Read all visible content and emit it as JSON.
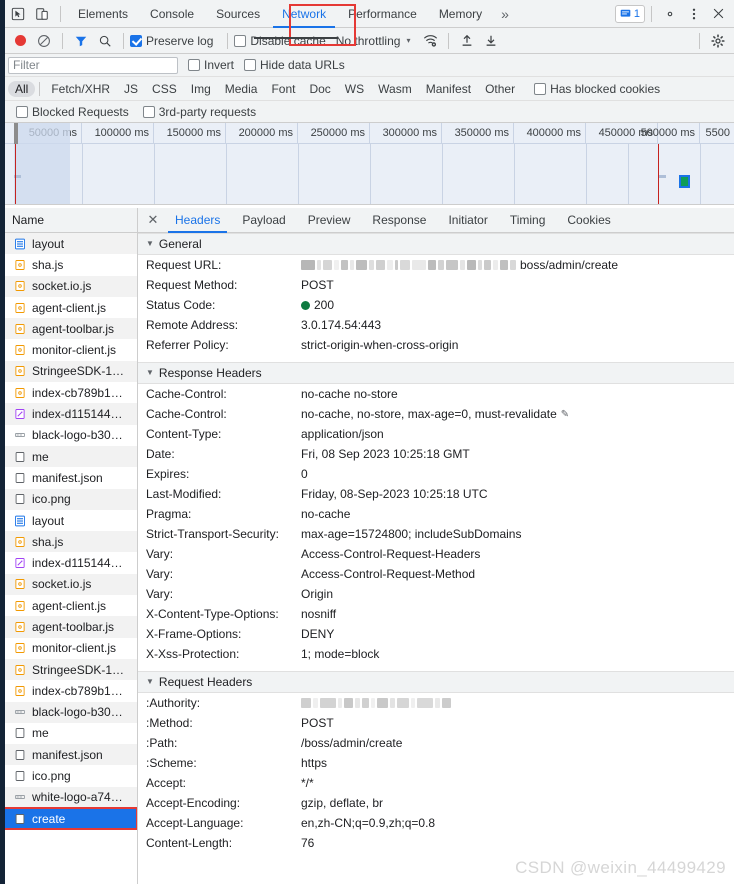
{
  "window": {
    "main_tabs": [
      {
        "label": "Elements",
        "selected": false
      },
      {
        "label": "Console",
        "selected": false
      },
      {
        "label": "Sources",
        "selected": false
      },
      {
        "label": "Network",
        "selected": true
      },
      {
        "label": "Performance",
        "selected": false
      },
      {
        "label": "Memory",
        "selected": false
      }
    ],
    "more_tabs_glyph": "»",
    "message_count": "1",
    "icons": {
      "inspect": "inspect-element-icon",
      "device": "device-toolbar-icon",
      "settings": "gear-icon",
      "kebab": "more-options-icon",
      "close": "close-icon"
    }
  },
  "toolbar": {
    "record_label": "record-button",
    "clear_label": "clear-button",
    "filter_toggle_label": "filter-toggle",
    "search_label": "search-button",
    "preserve_log": {
      "label": "Preserve log",
      "checked": true
    },
    "disable_cache": {
      "label": "Disable cache",
      "checked": false
    },
    "throttling": {
      "value": "No throttling",
      "caret": "▾"
    },
    "wifi_label": "network-conditions-icon",
    "import_label": "import-har-icon",
    "export_label": "export-har-icon",
    "settings_label": "network-settings-gear-icon"
  },
  "filters": {
    "filter_placeholder": "Filter",
    "filter_value": "",
    "invert": {
      "label": "Invert",
      "checked": false
    },
    "hide_data_urls": {
      "label": "Hide data URLs",
      "checked": false
    },
    "types": [
      {
        "label": "All",
        "selected": true
      },
      {
        "label": "Fetch/XHR",
        "selected": false
      },
      {
        "label": "JS",
        "selected": false
      },
      {
        "label": "CSS",
        "selected": false
      },
      {
        "label": "Img",
        "selected": false
      },
      {
        "label": "Media",
        "selected": false
      },
      {
        "label": "Font",
        "selected": false
      },
      {
        "label": "Doc",
        "selected": false
      },
      {
        "label": "WS",
        "selected": false
      },
      {
        "label": "Wasm",
        "selected": false
      },
      {
        "label": "Manifest",
        "selected": false
      },
      {
        "label": "Other",
        "selected": false
      }
    ],
    "has_blocked_cookies": {
      "label": "Has blocked cookies",
      "checked": false
    },
    "blocked_requests": {
      "label": "Blocked Requests",
      "checked": false
    },
    "third_party": {
      "label": "3rd-party requests",
      "checked": false
    }
  },
  "overview": {
    "ticks": [
      "50000 ms",
      "100000 ms",
      "150000 ms",
      "200000 ms",
      "250000 ms",
      "300000 ms",
      "350000 ms",
      "400000 ms",
      "450000 ms",
      "500000 ms",
      "5500"
    ],
    "marker_color": "#c5221f",
    "event_color": "#0f9d58"
  },
  "requests": {
    "column_header": "Name",
    "rows": [
      {
        "name": "layout",
        "icon": "document-icon"
      },
      {
        "name": "sha.js",
        "icon": "script-icon"
      },
      {
        "name": "socket.io.js",
        "icon": "script-icon"
      },
      {
        "name": "agent-client.js",
        "icon": "script-icon"
      },
      {
        "name": "agent-toolbar.js",
        "icon": "script-icon"
      },
      {
        "name": "monitor-client.js",
        "icon": "script-icon"
      },
      {
        "name": "StringeeSDK-1…",
        "icon": "script-icon"
      },
      {
        "name": "index-cb789b1…",
        "icon": "script-icon"
      },
      {
        "name": "index-d115144…",
        "icon": "stylesheet-icon"
      },
      {
        "name": "black-logo-b30…",
        "icon": "image-icon"
      },
      {
        "name": "me",
        "icon": "xhr-icon"
      },
      {
        "name": "manifest.json",
        "icon": "xhr-icon"
      },
      {
        "name": "ico.png",
        "icon": "xhr-icon"
      },
      {
        "name": "layout",
        "icon": "document-icon"
      },
      {
        "name": "sha.js",
        "icon": "script-icon"
      },
      {
        "name": "index-d115144…",
        "icon": "stylesheet-icon"
      },
      {
        "name": "socket.io.js",
        "icon": "script-icon"
      },
      {
        "name": "agent-client.js",
        "icon": "script-icon"
      },
      {
        "name": "agent-toolbar.js",
        "icon": "script-icon"
      },
      {
        "name": "monitor-client.js",
        "icon": "script-icon"
      },
      {
        "name": "StringeeSDK-1…",
        "icon": "script-icon"
      },
      {
        "name": "index-cb789b1…",
        "icon": "script-icon"
      },
      {
        "name": "black-logo-b30…",
        "icon": "image-icon"
      },
      {
        "name": "me",
        "icon": "xhr-icon"
      },
      {
        "name": "manifest.json",
        "icon": "xhr-icon"
      },
      {
        "name": "ico.png",
        "icon": "xhr-icon"
      },
      {
        "name": "white-logo-a74…",
        "icon": "image-icon"
      },
      {
        "name": "create",
        "icon": "xhr-icon",
        "selected": true,
        "annotated": true
      }
    ]
  },
  "detail": {
    "close_glyph": "✕",
    "tabs": [
      {
        "label": "Headers",
        "selected": true
      },
      {
        "label": "Payload",
        "selected": false
      },
      {
        "label": "Preview",
        "selected": false
      },
      {
        "label": "Response",
        "selected": false
      },
      {
        "label": "Initiator",
        "selected": false
      },
      {
        "label": "Timing",
        "selected": false
      },
      {
        "label": "Cookies",
        "selected": false
      }
    ],
    "sections": [
      {
        "title": "General",
        "rows": [
          {
            "key": "Request URL:",
            "value": "boss/admin/create",
            "redacted": true
          },
          {
            "key": "Request Method:",
            "value": "POST"
          },
          {
            "key": "Status Code:",
            "value": "200",
            "status": true
          },
          {
            "key": "Remote Address:",
            "value": "3.0.174.54:443"
          },
          {
            "key": "Referrer Policy:",
            "value": "strict-origin-when-cross-origin"
          }
        ]
      },
      {
        "title": "Response Headers",
        "rows": [
          {
            "key": "Cache-Control:",
            "value": "no-cache no-store"
          },
          {
            "key": "Cache-Control:",
            "value": "no-cache, no-store, max-age=0, must-revalidate",
            "pencil": true
          },
          {
            "key": "Content-Type:",
            "value": "application/json"
          },
          {
            "key": "Date:",
            "value": "Fri, 08 Sep 2023 10:25:18 GMT"
          },
          {
            "key": "Expires:",
            "value": "0"
          },
          {
            "key": "Last-Modified:",
            "value": "Friday, 08-Sep-2023 10:25:18 UTC"
          },
          {
            "key": "Pragma:",
            "value": "no-cache"
          },
          {
            "key": "Strict-Transport-Security:",
            "value": "max-age=15724800; includeSubDomains"
          },
          {
            "key": "Vary:",
            "value": "Access-Control-Request-Headers"
          },
          {
            "key": "Vary:",
            "value": "Access-Control-Request-Method"
          },
          {
            "key": "Vary:",
            "value": "Origin"
          },
          {
            "key": "X-Content-Type-Options:",
            "value": "nosniff"
          },
          {
            "key": "X-Frame-Options:",
            "value": "DENY"
          },
          {
            "key": "X-Xss-Protection:",
            "value": "1; mode=block"
          }
        ]
      },
      {
        "title": "Request Headers",
        "rows": [
          {
            "key": ":Authority:",
            "value": "",
            "redacted2": true
          },
          {
            "key": ":Method:",
            "value": "POST"
          },
          {
            "key": ":Path:",
            "value": "/boss/admin/create"
          },
          {
            "key": ":Scheme:",
            "value": "https"
          },
          {
            "key": "Accept:",
            "value": "*/*"
          },
          {
            "key": "Accept-Encoding:",
            "value": "gzip, deflate, br"
          },
          {
            "key": "Accept-Language:",
            "value": "en,zh-CN;q=0.9,zh;q=0.8"
          },
          {
            "key": "Content-Length:",
            "value": "76"
          }
        ]
      }
    ]
  },
  "watermark": "CSDN @weixin_44499429",
  "colors": {
    "accent": "#1a73e8",
    "annotation": "#e53935",
    "status_ok": "#0f7b41",
    "toolbar_bg": "#f1f3f4"
  }
}
